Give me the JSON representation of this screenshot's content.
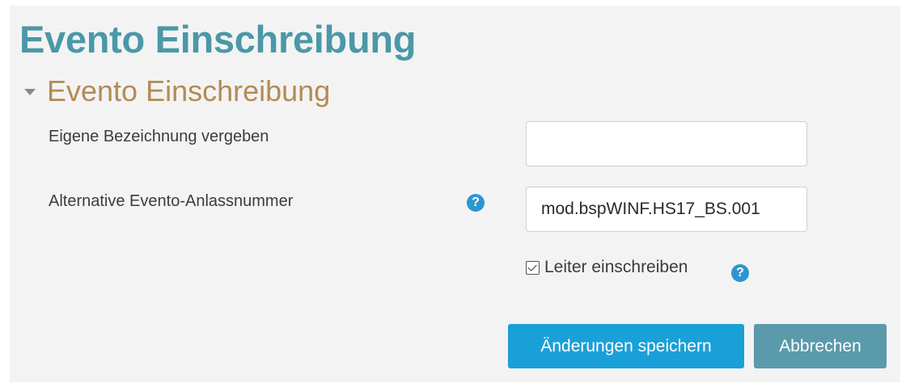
{
  "page": {
    "title": "Evento Einschreibung"
  },
  "section": {
    "title": "Evento Einschreibung",
    "expanded": true
  },
  "form": {
    "custom_name": {
      "label": "Eigene Bezeichnung vergeben",
      "value": "",
      "placeholder": ""
    },
    "alt_number": {
      "label": "Alternative Evento-Anlassnummer",
      "value": "mod.bspWINF.HS17_BS.001",
      "help_glyph": "?"
    },
    "enrol_leader": {
      "label": "Leiter einschreiben",
      "checked": true,
      "help_glyph": "?"
    }
  },
  "actions": {
    "save_label": "Änderungen speichern",
    "cancel_label": "Abbrechen"
  },
  "icons": {
    "collapse": "caret-down-icon",
    "help": "question-circle-icon"
  },
  "colors": {
    "title": "#4a98a8",
    "section_title": "#b38b55",
    "help_icon": "#2d96cf",
    "primary_button": "#1aa0d8",
    "secondary_button": "#5a9aab",
    "panel_background": "#f3f3f3"
  }
}
